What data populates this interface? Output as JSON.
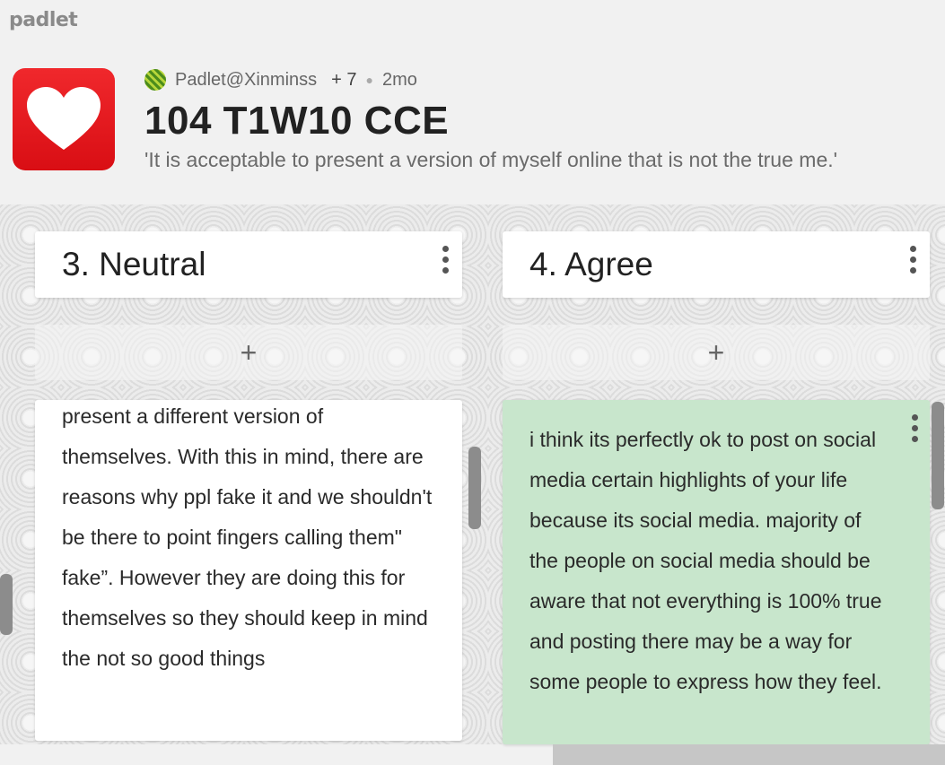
{
  "brand": "padlet",
  "header": {
    "author": "Padlet@Xinminss",
    "contributors": "+ 7",
    "time_ago": "2mo",
    "title": "104 T1W10 CCE",
    "description": "'It is acceptable to present a version of myself online that is not the true me.'"
  },
  "columns": [
    {
      "title": "3. Neutral",
      "add_label": "+",
      "card_text": "present a different version of themselves. With this in mind, there are reasons why ppl fake it and we shouldn't be there to point fingers calling them\" fake”. However they are doing this for themselves so they should keep in mind the not so good things",
      "card_color": "#ffffff"
    },
    {
      "title": "4. Agree",
      "add_label": "+",
      "card_text": "i think its perfectly ok to post on social media certain highlights of your life because its social media. majority of the people on social media should be aware that not everything is 100% true and posting there may be a way for some people to express how they feel.",
      "card_color": "#c8e6cc"
    }
  ],
  "icons": {
    "app": "heart-icon",
    "column_menu": "kebab-menu-icon",
    "card_menu": "kebab-menu-icon"
  },
  "colors": {
    "app_icon": "#e61b20",
    "background": "#f1f1f1"
  }
}
